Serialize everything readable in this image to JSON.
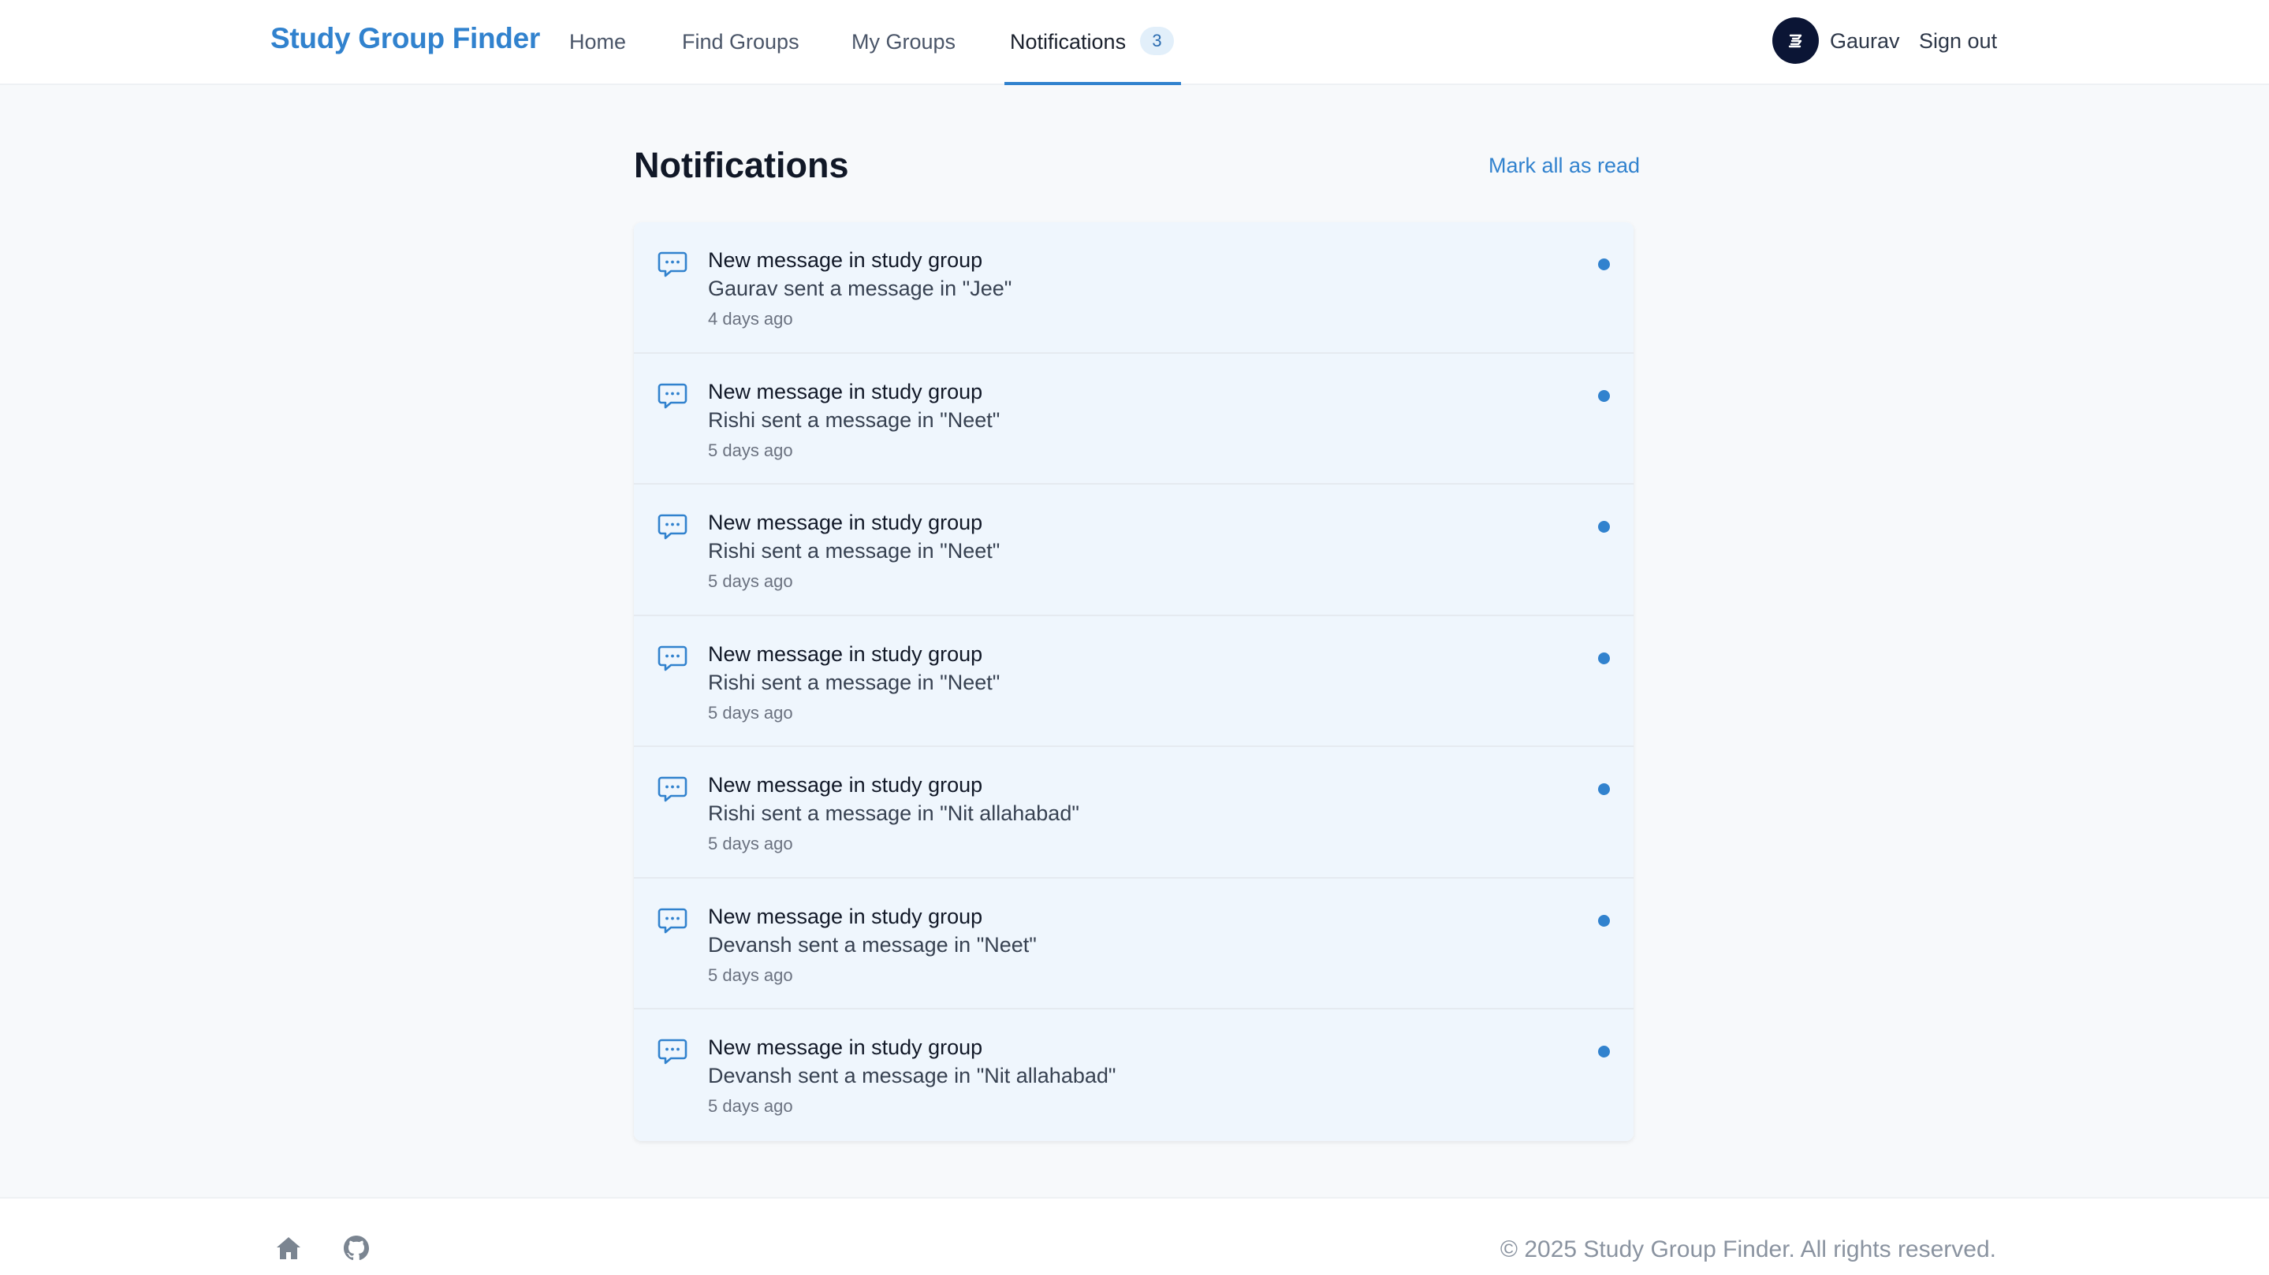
{
  "header": {
    "brand": "Study Group Finder",
    "nav": {
      "home": "Home",
      "find_groups": "Find Groups",
      "my_groups": "My Groups",
      "notifications": "Notifications",
      "notifications_count": "3"
    },
    "user": {
      "name": "Gaurav",
      "sign_out": "Sign out"
    }
  },
  "main": {
    "title": "Notifications",
    "mark_all_read": "Mark all as read",
    "notifications": [
      {
        "title": "New message in study group",
        "body": "Gaurav sent a message in \"Jee\"",
        "time": "4 days ago",
        "unread": true
      },
      {
        "title": "New message in study group",
        "body": "Rishi sent a message in \"Neet\"",
        "time": "5 days ago",
        "unread": true
      },
      {
        "title": "New message in study group",
        "body": "Rishi sent a message in \"Neet\"",
        "time": "5 days ago",
        "unread": true
      },
      {
        "title": "New message in study group",
        "body": "Rishi sent a message in \"Neet\"",
        "time": "5 days ago",
        "unread": true
      },
      {
        "title": "New message in study group",
        "body": "Rishi sent a message in \"Nit allahabad\"",
        "time": "5 days ago",
        "unread": true
      },
      {
        "title": "New message in study group",
        "body": "Devansh sent a message in \"Neet\"",
        "time": "5 days ago",
        "unread": true
      },
      {
        "title": "New message in study group",
        "body": "Devansh sent a message in \"Nit allahabad\"",
        "time": "5 days ago",
        "unread": true
      }
    ],
    "notification_icon": "chat-bubble-icon"
  },
  "footer": {
    "icons": [
      "home-icon",
      "github-icon"
    ],
    "copyright": "© 2025 Study Group Finder. All rights reserved."
  },
  "colors": {
    "accent": "#3182ce",
    "unread_background": "#eff6fd",
    "page_background": "#f7f9fb",
    "avatar": "#0b1535"
  }
}
